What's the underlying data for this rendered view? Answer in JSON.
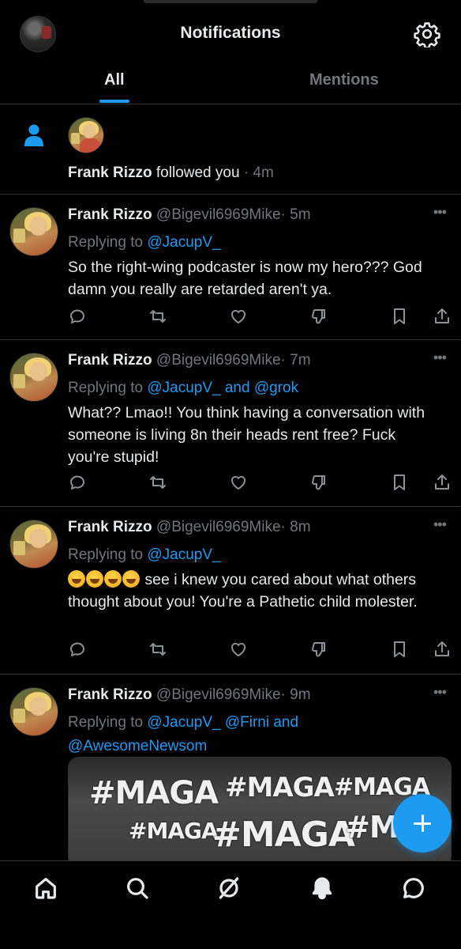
{
  "header": {
    "title": "Notifications"
  },
  "tabs": [
    {
      "label": "All",
      "active": true
    },
    {
      "label": "Mentions",
      "active": false
    }
  ],
  "follow_notification": {
    "name": "Frank Rizzo",
    "text": "followed you",
    "time": "· 4m"
  },
  "tweets": [
    {
      "name": "Frank Rizzo",
      "handle": "@Bigevil6969Mike",
      "time": "· 5m",
      "replying_prefix": "Replying to",
      "replying_to": "@JacupV_",
      "text": "So the right-wing podcaster is now my hero??? God damn you really are retarded aren't ya."
    },
    {
      "name": "Frank Rizzo",
      "handle": "@Bigevil6969Mike",
      "time": "· 7m",
      "replying_prefix": "Replying to",
      "replying_to": "@JacupV_ and @grok",
      "text": "What?? Lmao!! You think having a conversation with someone is living 8n their heads rent free? Fuck you're stupid!"
    },
    {
      "name": "Frank Rizzo",
      "handle": "@Bigevil6969Mike",
      "time": "· 8m",
      "replying_prefix": "Replying to",
      "replying_to": "@JacupV_",
      "text": "see i knew you cared about what others thought about you! You're a Pathetic child molester."
    },
    {
      "name": "Frank Rizzo",
      "handle": "@Bigevil6969Mike",
      "time": "· 9m",
      "replying_prefix": "Replying to",
      "replying_to": "@JacupV_ @Firni and",
      "replying_to_line2": "@AwesomeNewsom",
      "media_text": [
        "#MAGA",
        "#MAGA",
        "#MAGA",
        "#MAGA",
        "#MAGA",
        "#M"
      ]
    }
  ],
  "more_glyph": "•••",
  "colors": {
    "accent": "#1d9bf0",
    "background": "#000000",
    "muted": "#71767b"
  }
}
